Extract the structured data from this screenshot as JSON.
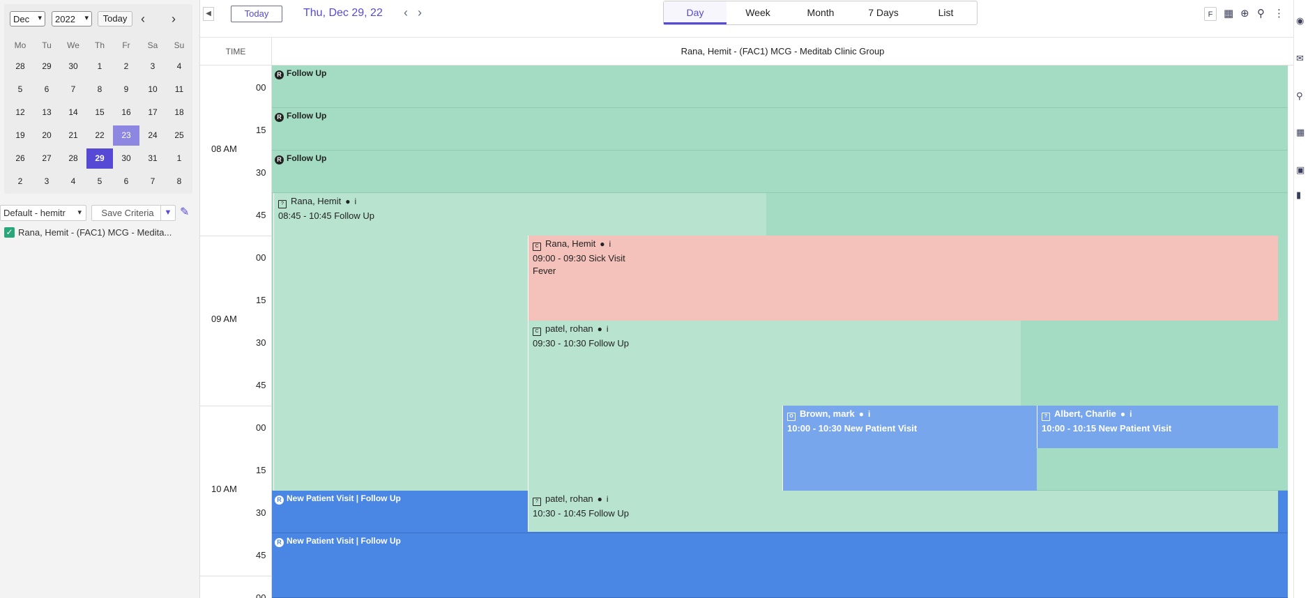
{
  "mini_calendar": {
    "month": "Dec",
    "year": "2022",
    "today_label": "Today",
    "weekdays": [
      "Mo",
      "Tu",
      "We",
      "Th",
      "Fr",
      "Sa",
      "Su"
    ],
    "weeks": [
      [
        "28",
        "29",
        "30",
        "1",
        "2",
        "3",
        "4"
      ],
      [
        "5",
        "6",
        "7",
        "8",
        "9",
        "10",
        "11"
      ],
      [
        "12",
        "13",
        "14",
        "15",
        "16",
        "17",
        "18"
      ],
      [
        "19",
        "20",
        "21",
        "22",
        "23",
        "24",
        "25"
      ],
      [
        "26",
        "27",
        "28",
        "29",
        "30",
        "31",
        "1"
      ],
      [
        "2",
        "3",
        "4",
        "5",
        "6",
        "7",
        "8"
      ]
    ]
  },
  "criteria": {
    "selected": "Default - hemitr",
    "save_label": "Save Criteria"
  },
  "resources": [
    {
      "label": "Rana, Hemit - (FAC1) MCG - Medita...",
      "checked": true
    }
  ],
  "toolbar": {
    "today_label": "Today",
    "current_date": "Thu, Dec 29, 22",
    "view_tabs": [
      "Day",
      "Week",
      "Month",
      "7 Days",
      "List"
    ],
    "active_view": "Day",
    "filter_badge": "F"
  },
  "scheduler": {
    "time_header": "TIME",
    "resource_header": "Rana, Hemit - (FAC1) MCG - Meditab Clinic Group",
    "hour_labels": [
      "08 AM",
      "09 AM",
      "10 AM"
    ],
    "minute_labels": [
      "00",
      "15",
      "30",
      "45",
      "00",
      "15",
      "30",
      "45",
      "00",
      "15",
      "30",
      "45",
      "00"
    ],
    "recurring_icon": "R",
    "slots": [
      {
        "label": "Follow Up",
        "color": "green"
      },
      {
        "label": "Follow Up",
        "color": "green"
      },
      {
        "label": "Follow Up",
        "color": "green"
      },
      {
        "label": "New Patient Visit | Follow Up",
        "color": "blue"
      },
      {
        "label": "New Patient Visit | Follow Up",
        "color": "blue"
      }
    ],
    "appointments": [
      {
        "patient": "Rana, Hemit",
        "time": "08:45 - 10:45 Follow Up",
        "note": "",
        "color": "#b8e3cf",
        "icon": "?"
      },
      {
        "patient": "Rana, Hemit",
        "time": "09:00 - 09:30 Sick Visit",
        "note": "Fever",
        "color": "#f4c2bb",
        "icon": "C"
      },
      {
        "patient": "patel, rohan",
        "time": "09:30 - 10:30 Follow Up",
        "note": "",
        "color": "#b8e3cf",
        "icon": "C"
      },
      {
        "patient": "Brown, mark",
        "time": "10:00 - 10:30 New Patient Visit",
        "note": "",
        "color": "#78a6ed",
        "icon": "O"
      },
      {
        "patient": "Albert, Charlie",
        "time": "10:00 - 10:15 New Patient Visit",
        "note": "",
        "color": "#78a6ed",
        "icon": "?"
      },
      {
        "patient": "patel, rohan",
        "time": "10:30 - 10:45 Follow Up",
        "note": "",
        "color": "#b8e3cf",
        "icon": "?"
      }
    ]
  },
  "colors": {
    "accent": "#5549d6",
    "slot_green": "#a3dcc2",
    "appt_green": "#b8e3cf",
    "appt_red": "#f4c2bb",
    "appt_blue": "#78a6ed",
    "slot_blue": "#4a86e4"
  },
  "icons": {
    "patient": "person-icon",
    "info": "info-icon",
    "appointment": "calendar-icon",
    "recurring": "recurring-icon"
  }
}
